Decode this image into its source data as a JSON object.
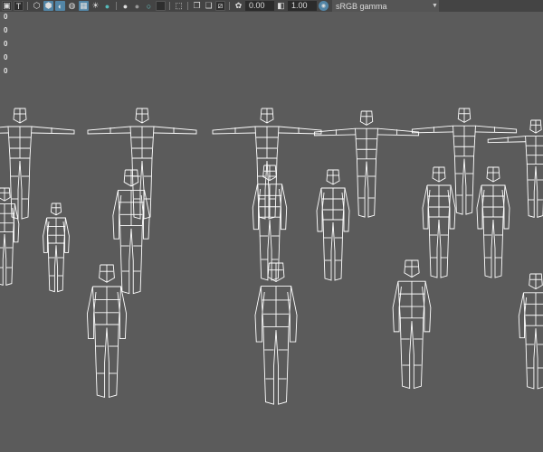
{
  "toolbar": {
    "exposure_value": "0.00",
    "gamma_value": "1.00",
    "color_space": "sRGB gamma",
    "icons": [
      "image-plane-icon",
      "text-icon",
      "wireframe-cube-icon",
      "smooth-shade-icon",
      "default-material-icon",
      "xray-icon",
      "checker-icon",
      "lights-icon",
      "shadows-icon",
      "ambient-occlusion-icon",
      "motion-blur-icon",
      "antialias-icon",
      "depth-of-field-icon",
      "select-icon",
      "isolate-icon",
      "resolution-gate-icon",
      "field-chart-icon",
      "exposure-icon",
      "gamma-icon",
      "color-management-icon"
    ]
  },
  "hud": {
    "values": [
      "0",
      "0",
      "0",
      "0",
      "0"
    ]
  },
  "colors": {
    "background": "#5b5b5b",
    "wire": "#ffffff",
    "accent": "#5285a6"
  }
}
